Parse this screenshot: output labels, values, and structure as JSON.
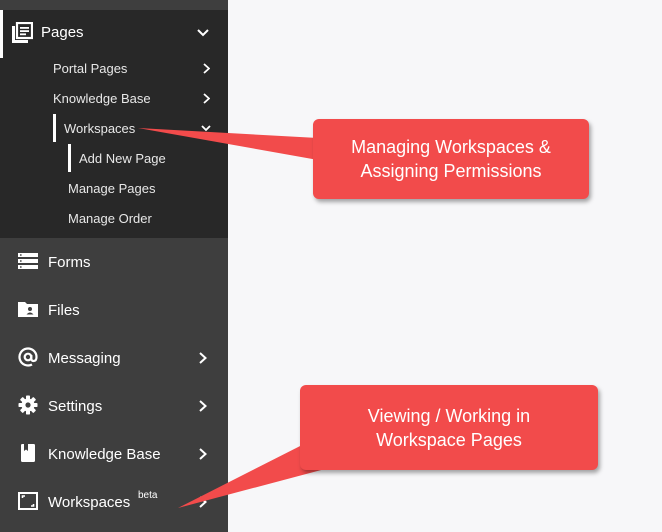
{
  "sidebar": {
    "pages": {
      "label": "Pages",
      "icon": "pages-icon",
      "subitems": [
        {
          "label": "Portal Pages"
        },
        {
          "label": "Knowledge Base"
        },
        {
          "label": "Workspaces"
        }
      ],
      "workspace_children": [
        {
          "label": "Add New Page"
        },
        {
          "label": "Manage Pages"
        },
        {
          "label": "Manage Order"
        }
      ]
    },
    "items": [
      {
        "label": "Forms",
        "icon": "forms-icon"
      },
      {
        "label": "Files",
        "icon": "files-icon"
      },
      {
        "label": "Messaging",
        "icon": "at-icon"
      },
      {
        "label": "Settings",
        "icon": "gear-icon"
      },
      {
        "label": "Knowledge Base",
        "icon": "book-icon"
      },
      {
        "label": "Workspaces",
        "icon": "workspace-icon",
        "badge": "beta"
      }
    ]
  },
  "callouts": {
    "managing": "Managing Workspaces &\nAssigning Permissions",
    "viewing": "Viewing / Working in\nWorkspace Pages"
  },
  "colors": {
    "sidebar_bg": "#3e3e3e",
    "pages_block_bg": "#282828",
    "callout_red": "#f24b4b",
    "content_bg": "#f7f7f9"
  }
}
